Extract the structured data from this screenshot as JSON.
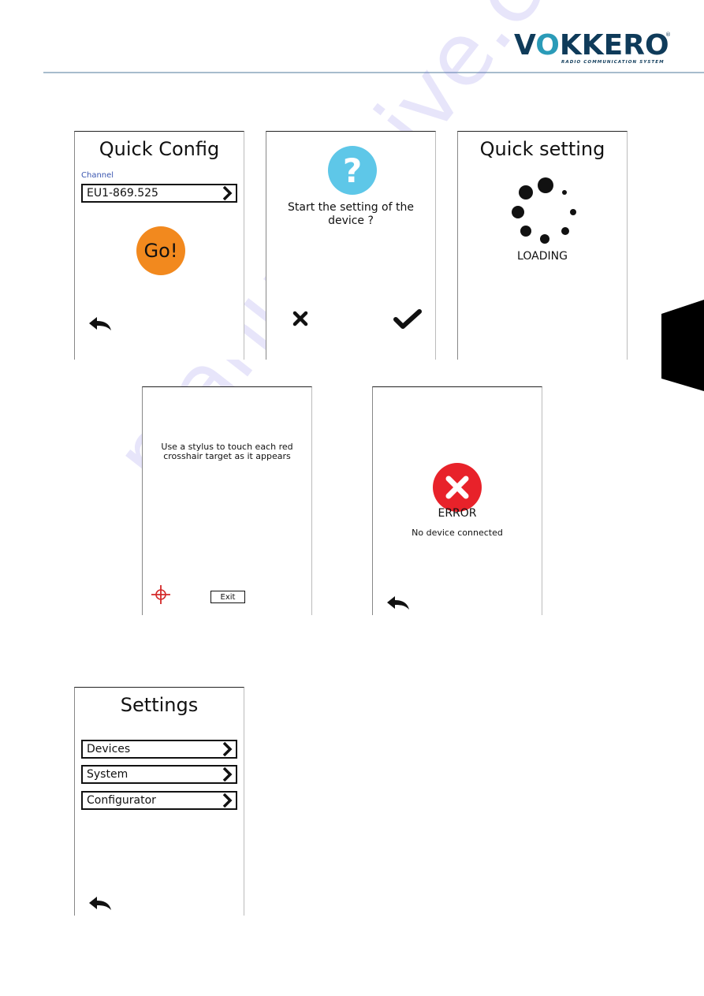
{
  "header": {
    "brand_prefix": "V",
    "brand_o": "O",
    "brand_suffix": "KKERO",
    "registered_mark": "®",
    "tagline": "RADIO COMMUNICATION SYSTEM",
    "colors": {
      "brand_navy": "#0f3b5a",
      "brand_teal": "#2a9bb8",
      "rule": "#a7bccd"
    }
  },
  "screens": {
    "quick_config": {
      "title": "Quick Config",
      "channel_label": "Channel",
      "channel_value": "EU1-869.525",
      "go_label": "Go!",
      "back_icon": "back-arrow-icon",
      "go_color": "#f2891e",
      "label_color": "#3a56b0"
    },
    "confirm": {
      "icon": "question-icon",
      "icon_glyph": "?",
      "icon_color": "#5ec7e8",
      "message_line1": "Start the setting of the",
      "message_line2": "device ?",
      "cancel_icon": "cross-icon",
      "confirm_icon": "checkmark-icon"
    },
    "quick_setting": {
      "title": "Quick setting",
      "status": "LOADING",
      "spinner_icon": "loading-spinner-icon"
    },
    "calibration": {
      "instruction_line1": "Use a stylus to touch each red",
      "instruction_line2": "crosshair target as it appears",
      "exit_label": "Exit",
      "target_icon": "crosshair-icon",
      "target_color": "#d42a2a"
    },
    "error": {
      "title": "ERROR",
      "message": "No device connected",
      "icon": "error-x-icon",
      "icon_color": "#e8222a"
    },
    "settings": {
      "title": "Settings",
      "items": [
        {
          "label": "Devices"
        },
        {
          "label": "System"
        },
        {
          "label": "Configurator"
        }
      ]
    }
  },
  "watermark": "manualshive.com"
}
